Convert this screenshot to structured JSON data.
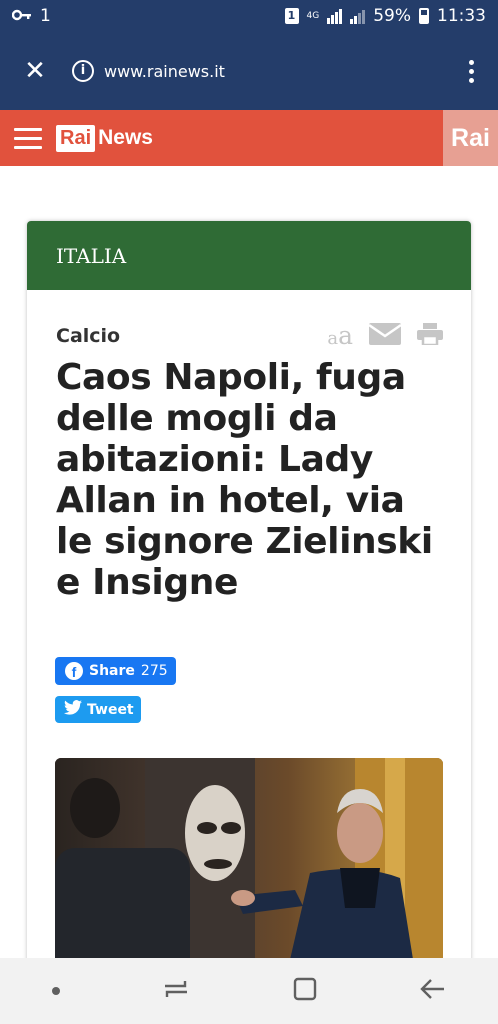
{
  "status_bar": {
    "signal_indicator": "1",
    "network_type": "4G",
    "battery_percent": "59%",
    "time": "11:33",
    "sim_badge": "1",
    "icons": [
      "key-icon",
      "sim-icon",
      "signal-icon",
      "battery-icon"
    ]
  },
  "browser": {
    "url": "www.rainews.it",
    "icons": [
      "close-icon",
      "info-icon",
      "more-vert-icon"
    ]
  },
  "site_header": {
    "logo_rai": "Rai",
    "logo_news": "News",
    "rai_corner": "Rai",
    "accent_color": "#e1523d"
  },
  "article": {
    "section": "ITALIA",
    "section_color": "#2f6b35",
    "category": "Calcio",
    "font_size_small": "a",
    "font_size_large": "a",
    "headline": "Caos Napoli, fuga delle mogli da abitazioni: Lady Allan in hotel, via le signore Zielinski e Insigne",
    "share": {
      "facebook_label": "Share",
      "facebook_count": "275",
      "tweet_label": "Tweet"
    }
  },
  "nav_bar": {
    "icons": [
      "dot-icon",
      "recent-apps-icon",
      "home-icon",
      "back-icon"
    ]
  }
}
